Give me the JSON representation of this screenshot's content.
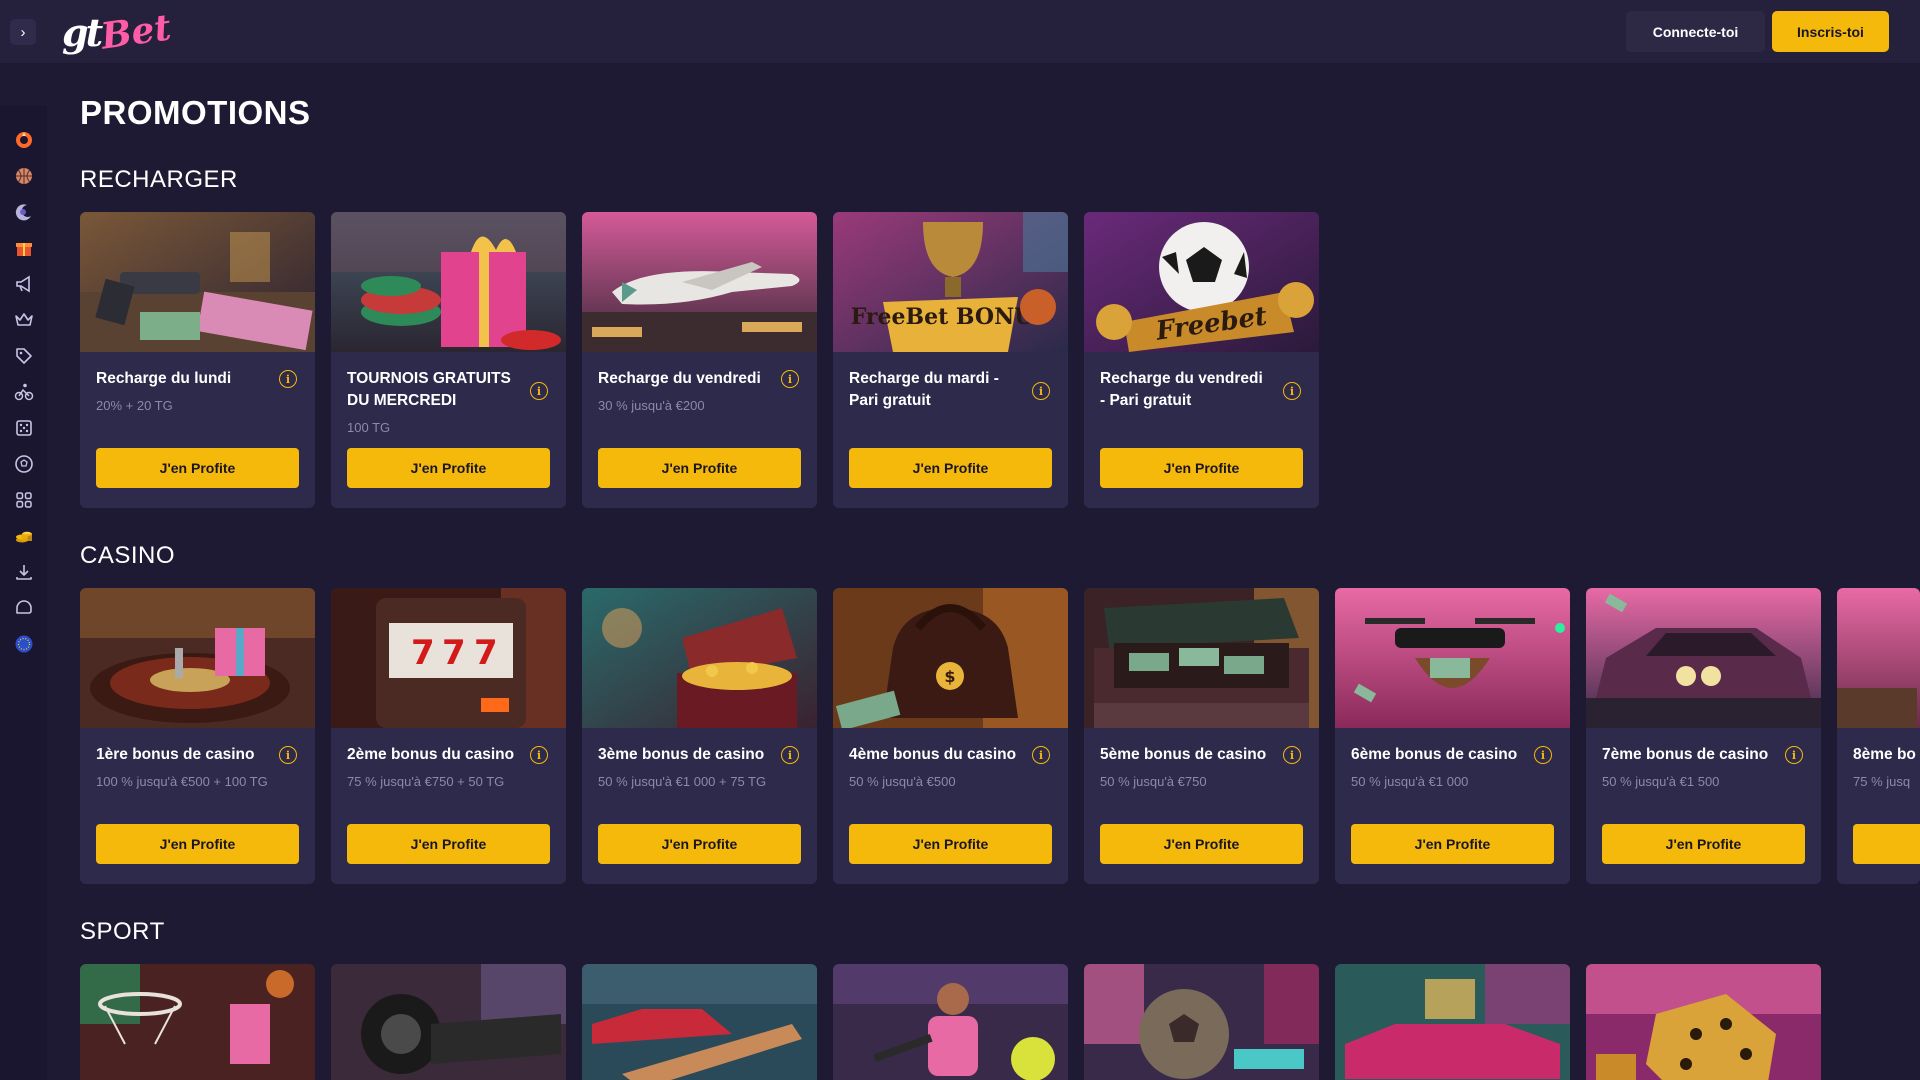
{
  "header": {
    "login_label": "Connecte-toi",
    "signup_label": "Inscris-toi",
    "logo_main": "gt",
    "logo_accent": "Bet"
  },
  "sidebar": {
    "items": [
      {
        "icon": "promo-spin-icon",
        "color": "#ff6a2b"
      },
      {
        "icon": "basketball-icon",
        "color": "#e8a07a"
      },
      {
        "icon": "moon-icon",
        "color": "#b9b4d9"
      },
      {
        "icon": "gift-box-icon",
        "color": "#ff7b2e"
      },
      {
        "icon": "megaphone-icon",
        "color": "#c9c4e4"
      },
      {
        "icon": "crown-icon",
        "color": "#c9c4e4"
      },
      {
        "icon": "tag-icon",
        "color": "#c9c4e4"
      },
      {
        "icon": "cycling-icon",
        "color": "#c9c4e4"
      },
      {
        "icon": "dice-icon",
        "color": "#c9c4e4"
      },
      {
        "icon": "soccer-ball-icon",
        "color": "#c9c4e4"
      },
      {
        "icon": "grid-icon",
        "color": "#c9c4e4"
      },
      {
        "icon": "coins-icon",
        "color": "#f5b90b"
      },
      {
        "icon": "download-icon",
        "color": "#c9c4e4"
      },
      {
        "icon": "chat-icon",
        "color": "#c9c4e4"
      },
      {
        "icon": "eu-flag-icon",
        "color": "#2a4fc9"
      }
    ]
  },
  "page": {
    "title": "PROMOTIONS"
  },
  "sections": {
    "recharger": {
      "title": "RECHARGER",
      "cards": [
        {
          "title": "Recharge du lundi",
          "sub": "20% + 20 TG",
          "button": "J'en Profite",
          "image": "pistol-and-cash"
        },
        {
          "title": "TOURNOIS GRATUITS DU MERCREDI",
          "sub": "100 TG",
          "button": "J'en Profite",
          "image": "gift-and-chips"
        },
        {
          "title": "Recharge du vendredi",
          "sub": "30 % jusqu'à €200",
          "button": "J'en Profite",
          "image": "private-jet"
        },
        {
          "title": "Recharge du mardi - Pari gratuit",
          "sub": "",
          "button": "J'en Profite",
          "image": "freebet-bonus-trophy",
          "image_text": "FreeBet BONUS"
        },
        {
          "title": "Recharge du vendredi - Pari gratuit",
          "sub": "",
          "button": "J'en Profite",
          "image": "soccer-ball-freebet",
          "image_text": "Freebet"
        }
      ]
    },
    "casino": {
      "title": "CASINO",
      "cards": [
        {
          "title": "1ère bonus de casino",
          "sub": "100 % jusqu'à €500 + 100 TG",
          "button": "J'en Profite",
          "image": "roulette-gift"
        },
        {
          "title": "2ème bonus du casino",
          "sub": "75 % jusqu'à €750 + 50 TG",
          "button": "J'en Profite",
          "image": "slot-machine"
        },
        {
          "title": "3ème bonus de casino",
          "sub": "50 % jusqu'à €1 000 + 75 TG",
          "button": "J'en Profite",
          "image": "treasure-chest"
        },
        {
          "title": "4ème bonus du casino",
          "sub": "50 % jusqu'à €500",
          "button": "J'en Profite",
          "image": "money-bag"
        },
        {
          "title": "5ème bonus de casino",
          "sub": "50 % jusqu'à €750",
          "button": "J'en Profite",
          "image": "car-trunk-cash"
        },
        {
          "title": "6ème bonus de casino",
          "sub": "50 % jusqu'à €1 000",
          "button": "J'en Profite",
          "image": "drone-cash"
        },
        {
          "title": "7ème bonus de casino",
          "sub": "50 % jusqu'à €1 500",
          "button": "J'en Profite",
          "image": "muscle-car"
        },
        {
          "title": "8ème bo",
          "sub": "75 % jusq",
          "button": "J",
          "image": "partial-card"
        }
      ]
    },
    "sport": {
      "title": "SPORT",
      "cards": [
        {
          "image": "basketball-dunk"
        },
        {
          "image": "formula-one"
        },
        {
          "image": "hockey-stick-car"
        },
        {
          "image": "tennis-player"
        },
        {
          "image": "soccer-ball-street"
        },
        {
          "image": "convertible-cash"
        },
        {
          "image": "golden-dice"
        }
      ]
    }
  },
  "colors": {
    "background": "#1e1a33",
    "header": "#25213d",
    "card": "#2e2a4c",
    "accent": "#f5b90b",
    "muted_text": "#8e89a8"
  }
}
